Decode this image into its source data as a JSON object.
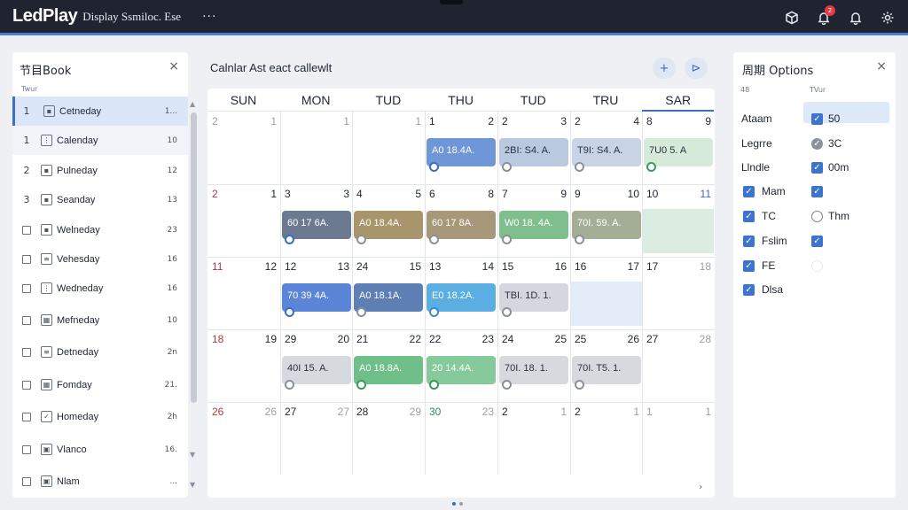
{
  "app": {
    "brand": "LedPlay",
    "subtitle": "Display Ssmiloc. Ese",
    "more": "···",
    "icons": [
      "cube-icon",
      "bell-icon",
      "bell-icon",
      "settings-icon"
    ],
    "badge_count": "2"
  },
  "left_panel": {
    "title": "节目Book",
    "close": "×",
    "subheader": "Twur",
    "items": [
      {
        "num": "1",
        "icon": "square-icon",
        "label": "Cetneday",
        "value": "1...",
        "selected": true
      },
      {
        "num": "1",
        "icon": "dots-icon",
        "label": "Calenday",
        "value": "10"
      },
      {
        "num": "2",
        "icon": "square-icon",
        "label": "Pulneday",
        "value": "12"
      },
      {
        "num": "3",
        "icon": "square-icon",
        "label": "Seanday",
        "value": "13"
      },
      {
        "num": "",
        "icon": "square-icon",
        "label": "Welneday",
        "value": "23"
      },
      {
        "num": "",
        "icon": "list-icon",
        "label": "Vehesday",
        "value": "16"
      },
      {
        "num": "",
        "icon": "grid-icon",
        "label": "Wedneday",
        "value": "16"
      },
      {
        "num": "",
        "icon": "calendar-icon",
        "label": "Mefneday",
        "value": "10"
      },
      {
        "num": "",
        "icon": "doc-icon",
        "label": "Detneday",
        "value": "2n"
      },
      {
        "num": "",
        "icon": "table-icon",
        "label": "Fomday",
        "value": "21."
      },
      {
        "num": "",
        "icon": "check-icon",
        "label": "Homeday",
        "value": "2h"
      },
      {
        "num": "",
        "icon": "box-icon",
        "label": "Vlanco",
        "value": "16."
      },
      {
        "num": "",
        "icon": "box-icon",
        "label": "Nlam",
        "value": "..."
      }
    ]
  },
  "calendar": {
    "title": "Calnlar Ast eact callewlt",
    "buttons": [
      "+",
      "⊳"
    ],
    "day_names": [
      "SUN",
      "MON",
      "TUD",
      "THU",
      "TUD",
      "TRU",
      "SAR"
    ],
    "weeks": [
      [
        {
          "a": "2",
          "b": "1",
          "ac": "gray",
          "bc": "gray"
        },
        {
          "a": "",
          "b": "1",
          "bc": "gray"
        },
        {
          "a": "",
          "b": "1",
          "bc": "gray"
        },
        {
          "a": "1",
          "b": "2"
        },
        {
          "a": "2",
          "b": "3"
        },
        {
          "a": "2",
          "b": "4"
        },
        {
          "a": "8",
          "b": "9"
        }
      ],
      [
        {
          "a": "2",
          "b": "1",
          "ac": "red"
        },
        {
          "a": "3",
          "b": "3"
        },
        {
          "a": "4",
          "b": "5"
        },
        {
          "a": "6",
          "b": "8"
        },
        {
          "a": "7",
          "b": "9"
        },
        {
          "a": "9",
          "b": "10"
        },
        {
          "a": "10",
          "b": "11",
          "bc": "blue"
        }
      ],
      [
        {
          "a": "11",
          "b": "12",
          "ac": "red"
        },
        {
          "a": "12",
          "b": "13"
        },
        {
          "a": "24",
          "b": "15"
        },
        {
          "a": "13",
          "b": "14"
        },
        {
          "a": "15",
          "b": "16"
        },
        {
          "a": "16",
          "b": "17"
        },
        {
          "a": "17",
          "b": "18",
          "bc": "gray"
        }
      ],
      [
        {
          "a": "18",
          "b": "19",
          "ac": "red"
        },
        {
          "a": "29",
          "b": "20"
        },
        {
          "a": "21",
          "b": "22"
        },
        {
          "a": "22",
          "b": "23"
        },
        {
          "a": "24",
          "b": "25"
        },
        {
          "a": "25",
          "b": "26"
        },
        {
          "a": "27",
          "b": "28",
          "bc": "gray"
        }
      ],
      [
        {
          "a": "26",
          "b": "26",
          "ac": "red",
          "bc": "gray"
        },
        {
          "a": "27",
          "b": "27",
          "bc": "gray"
        },
        {
          "a": "28",
          "b": "29",
          "bc": "gray"
        },
        {
          "a": "30",
          "b": "23",
          "ac": "green",
          "bc": "gray"
        },
        {
          "a": "2",
          "b": "1",
          "bc": "gray"
        },
        {
          "a": "2",
          "b": "1",
          "bc": "gray"
        },
        {
          "a": "1",
          "b": "1",
          "ac": "gray",
          "bc": "gray"
        }
      ]
    ],
    "events": [
      {
        "week": 0,
        "col": 3,
        "text": "A0 18.4A.",
        "color": "#6f96d6",
        "dot": "#3c6cc4"
      },
      {
        "week": 0,
        "col": 4,
        "text": "2BI: S4. A.",
        "color": "#b9c9e0",
        "dot": "#8a909c",
        "dark": true
      },
      {
        "week": 0,
        "col": 5,
        "text": "T9I: S4. A.",
        "color": "#c8d4e6",
        "dot": "#8a909c",
        "dark": true
      },
      {
        "week": 0,
        "col": 6,
        "text": "7U0 5. A",
        "color": "#d6ead9",
        "dot": "#3a9a5c",
        "dark": true
      },
      {
        "week": 1,
        "col": 1,
        "text": "60 17 6A.",
        "color": "#6b7a90",
        "dot": "#3c6cc4"
      },
      {
        "week": 1,
        "col": 2,
        "text": "A0 18.4A.",
        "color": "#a8956c",
        "dot": "#8a909c"
      },
      {
        "week": 1,
        "col": 3,
        "text": "60 17 8A.",
        "color": "#a8987a",
        "dot": "#8a909c"
      },
      {
        "week": 1,
        "col": 4,
        "text": "W0 18. 4A.",
        "color": "#7fbf8e",
        "dot": "#8a909c"
      },
      {
        "week": 1,
        "col": 5,
        "text": "70I. 59. A.",
        "color": "#a4ae96",
        "dot": "#8a909c"
      },
      {
        "week": 2,
        "col": 1,
        "text": "70 39 4A.",
        "color": "#5b86d8",
        "dot": "#3c6cc4"
      },
      {
        "week": 2,
        "col": 2,
        "text": "A0 18.1A.",
        "color": "#5e7fb4",
        "dot": "#8a909c"
      },
      {
        "week": 2,
        "col": 3,
        "text": "E0 18.2A.",
        "color": "#5aaee2",
        "dot": "#3c8bd0"
      },
      {
        "week": 2,
        "col": 4,
        "text": "TBI. 1D. 1.",
        "color": "#d4d8de",
        "dot": "#8a909c",
        "dark": true
      },
      {
        "week": 3,
        "col": 1,
        "text": "40I 15. A.",
        "color": "#d6d9de",
        "dot": "#8a909c",
        "dark": true
      },
      {
        "week": 3,
        "col": 2,
        "text": "A0 18.8A.",
        "color": "#6fbf88",
        "dot": "#3a9a5c"
      },
      {
        "week": 3,
        "col": 3,
        "text": "20 14.4A.",
        "color": "#86c99b",
        "dot": "#3a9a5c"
      },
      {
        "week": 3,
        "col": 4,
        "text": "70I. 18. 1.",
        "color": "#d6d9de",
        "dot": "#8a909c",
        "dark": true
      },
      {
        "week": 3,
        "col": 5,
        "text": "70I. T5. 1.",
        "color": "#d6d9de",
        "dot": "#8a909c",
        "dark": true
      }
    ],
    "next": "›"
  },
  "right_panel": {
    "title": "周期 Options",
    "close": "×",
    "header_left": "48",
    "header_right": "TVur",
    "rows": [
      {
        "left": "Ataam",
        "right_ctrl": "checkbox",
        "right_text": "50"
      },
      {
        "left": "Legrre",
        "right_ctrl": "check-gray",
        "right_text": "3C"
      },
      {
        "left": "Llndle",
        "right_ctrl": "checkbox",
        "right_text": "00m"
      },
      {
        "left_ctrl": "checkbox",
        "left": "Mam",
        "right_ctrl": "checkbox",
        "right_text": ""
      },
      {
        "left_ctrl": "checkbox",
        "left": "TC",
        "right_ctrl": "radio",
        "right_text": "Thm"
      },
      {
        "left_ctrl": "checkbox",
        "left": "Fslim",
        "right_ctrl": "checkbox",
        "right_text": ""
      },
      {
        "left_ctrl": "checkbox",
        "left": "FE",
        "right_ctrl": "radio-faint",
        "right_text": ""
      },
      {
        "left_ctrl": "checkbox",
        "left": "Dlsa",
        "right_ctrl": "",
        "right_text": ""
      }
    ]
  }
}
